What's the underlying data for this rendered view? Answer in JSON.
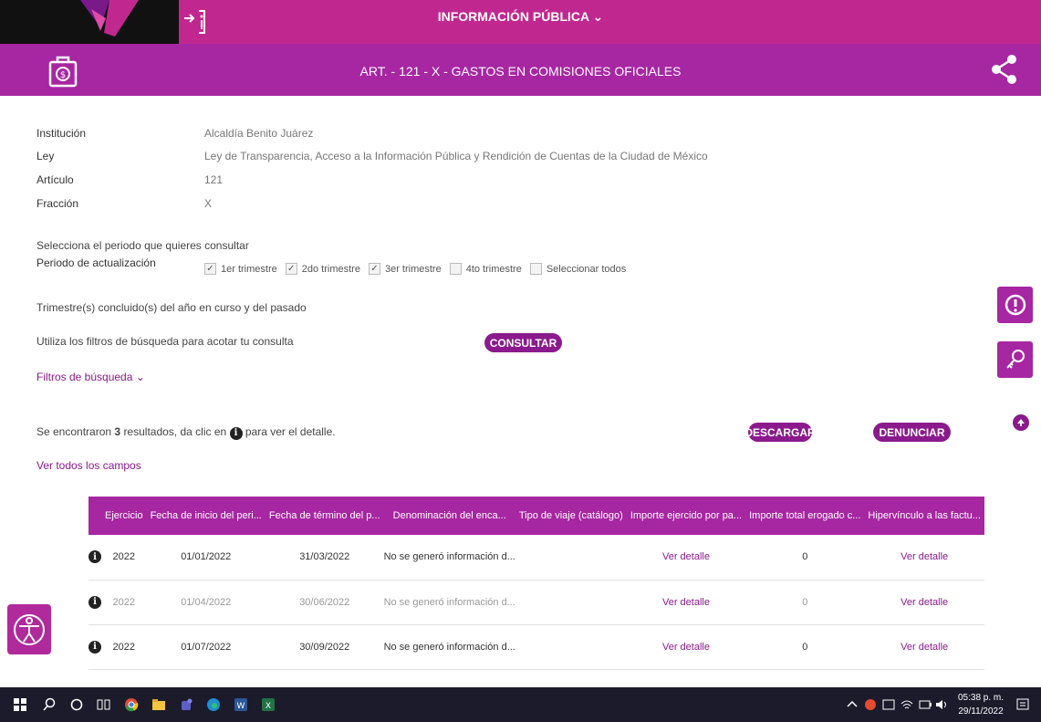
{
  "header": {
    "title": "INFORMACIÓN PÚBLICA",
    "article_title": "ART. - 121 - X - GASTOS EN COMISIONES OFICIALES"
  },
  "info": {
    "rows": [
      {
        "label": "Institución",
        "value": "Alcaldía Benito Juárez"
      },
      {
        "label": "Ley",
        "value": "Ley de Transparencia, Acceso a la Información Pública y Rendición de Cuentas de la Ciudad de México"
      },
      {
        "label": "Artículo",
        "value": "121"
      },
      {
        "label": "Fracción",
        "value": "X"
      }
    ]
  },
  "period": {
    "prompt": "Selecciona el periodo que quieres consultar",
    "label": "Periodo de actualización",
    "options": [
      {
        "label": "1er trimestre",
        "checked": true
      },
      {
        "label": "2do trimestre",
        "checked": true
      },
      {
        "label": "3er trimestre",
        "checked": true
      },
      {
        "label": "4to trimestre",
        "checked": false
      },
      {
        "label": "Seleccionar todos",
        "checked": false
      }
    ],
    "note": "Trimestre(s) concluido(s) del año en curso y del pasado"
  },
  "filters": {
    "hint": "Utiliza los filtros de búsqueda para acotar tu consulta",
    "consult_label": "CONSULTAR",
    "toggle_label": "Filtros de búsqueda"
  },
  "results": {
    "prefix": "Se encontraron",
    "count": "3",
    "middle": "resultados, da clic en",
    "suffix": "para ver el detalle.",
    "download_label": "DESCARGAR",
    "report_label": "DENUNCIAR",
    "all_fields_label": "Ver todos los campos"
  },
  "table": {
    "columns": [
      "Ejercicio",
      "Fecha de inicio del peri...",
      "Fecha de término del p...",
      "Denominación del enca...",
      "Tipo de viaje (catálogo)",
      "Importe ejercido por pa...",
      "Importe total erogado c...",
      "Hipervínculo a las factu..."
    ],
    "rows": [
      {
        "year": "2022",
        "start": "01/01/2022",
        "end": "31/03/2022",
        "name": "No se generó información d...",
        "type": "",
        "amount": "Ver detalle",
        "total": "0",
        "link": "Ver detalle"
      },
      {
        "year": "2022",
        "start": "01/04/2022",
        "end": "30/06/2022",
        "name": "No se generó información d...",
        "type": "",
        "amount": "Ver detalle",
        "total": "0",
        "link": "Ver detalle"
      },
      {
        "year": "2022",
        "start": "01/07/2022",
        "end": "30/09/2022",
        "name": "No se generó información d...",
        "type": "",
        "amount": "Ver detalle",
        "total": "0",
        "link": "Ver detalle"
      }
    ]
  },
  "taskbar": {
    "time": "05:38 p. m.",
    "date": "29/11/2022"
  },
  "colors": {
    "primary": "#a726a2",
    "top_bar": "#c1288f",
    "button": "#8b1a8d"
  }
}
